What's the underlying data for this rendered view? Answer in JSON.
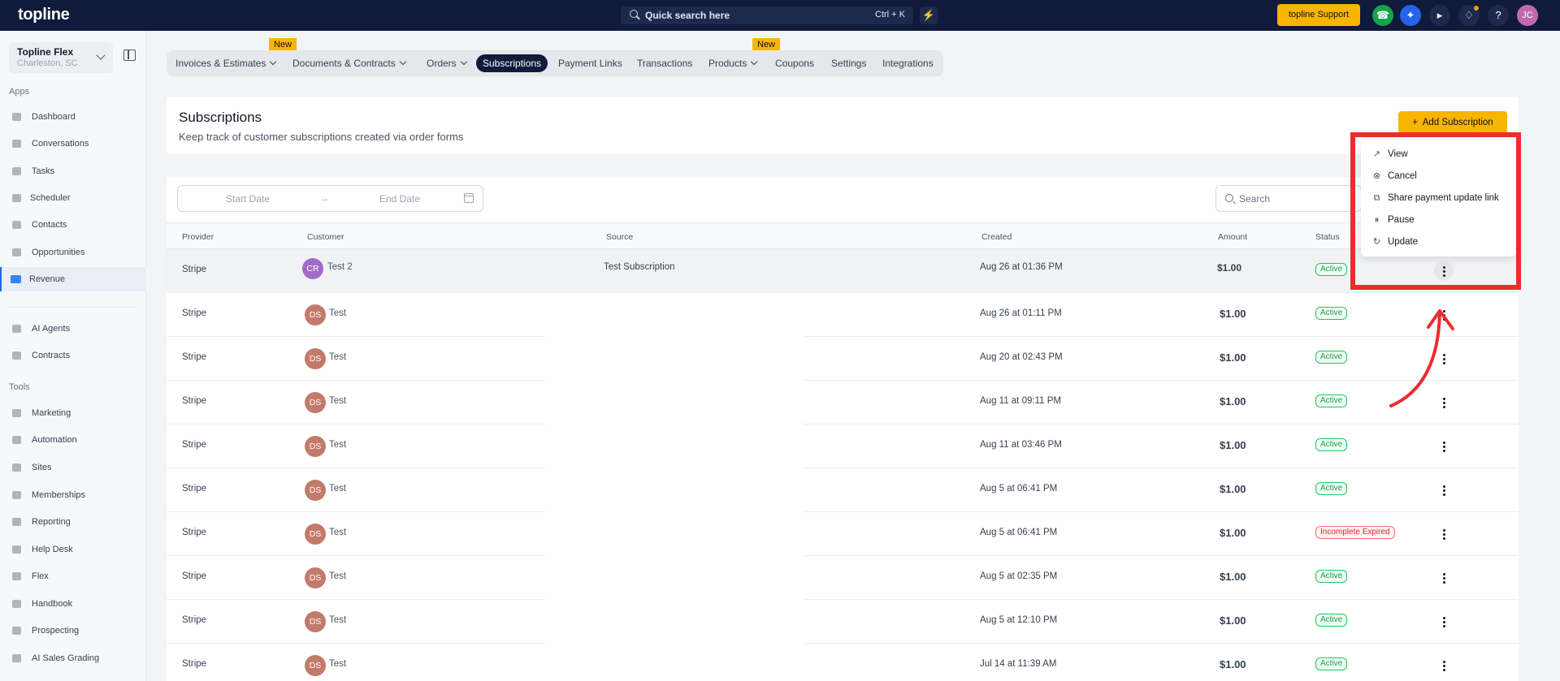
{
  "topbar": {
    "logo": "topline",
    "quick_search": "Quick search here",
    "shortcut": "Ctrl + K",
    "support_label": "topline Support",
    "user_initials": "JC"
  },
  "sidebar": {
    "location_name": "Topline Flex",
    "location_sub": "Charleston, SC",
    "apps_label": "Apps",
    "apps": [
      "Dashboard",
      "Conversations",
      "Tasks",
      "Scheduler",
      "Contacts",
      "Opportunities",
      "Revenue"
    ],
    "extra": [
      "AI Agents",
      "Contracts"
    ],
    "tools_label": "Tools",
    "tools": [
      "Marketing",
      "Automation",
      "Sites",
      "Memberships",
      "Reporting",
      "Help Desk",
      "Flex",
      "Handbook",
      "Prospecting",
      "AI Sales Grading"
    ]
  },
  "tabs": [
    "Invoices & Estimates",
    "Documents & Contracts",
    "Orders",
    "Subscriptions",
    "Payment Links",
    "Transactions",
    "Products",
    "Coupons",
    "Settings",
    "Integrations"
  ],
  "new_badge": "New",
  "header": {
    "title": "Subscriptions",
    "subtitle": "Keep track of customer subscriptions created via order forms",
    "add_button": "Add Subscription"
  },
  "filters": {
    "start_date": "Start Date",
    "end_date": "End Date",
    "search_placeholder": "Search"
  },
  "table": {
    "columns": [
      "Provider",
      "Customer",
      "Source",
      "Created",
      "Amount",
      "Status"
    ],
    "rows": [
      {
        "provider": "Stripe",
        "initials": "CR",
        "customer": "Test 2",
        "source": "Test Subscription",
        "created": "Aug 26 at 01:36 PM",
        "amount": "$1.00",
        "status": "Active"
      },
      {
        "provider": "Stripe",
        "initials": "DS",
        "customer": "Test",
        "source": "",
        "created": "Aug 26 at 01:11 PM",
        "amount": "$1.00",
        "status": "Active"
      },
      {
        "provider": "Stripe",
        "initials": "DS",
        "customer": "Test",
        "source": "",
        "created": "Aug 20 at 02:43 PM",
        "amount": "$1.00",
        "status": "Active"
      },
      {
        "provider": "Stripe",
        "initials": "DS",
        "customer": "Test",
        "source": "",
        "created": "Aug 11 at 09:11 PM",
        "amount": "$1.00",
        "status": "Active"
      },
      {
        "provider": "Stripe",
        "initials": "DS",
        "customer": "Test",
        "source": "",
        "created": "Aug 11 at 03:46 PM",
        "amount": "$1.00",
        "status": "Active"
      },
      {
        "provider": "Stripe",
        "initials": "DS",
        "customer": "Test",
        "source": "",
        "created": "Aug 5 at 06:41 PM",
        "amount": "$1.00",
        "status": "Active"
      },
      {
        "provider": "Stripe",
        "initials": "DS",
        "customer": "Test",
        "source": "",
        "created": "Aug 5 at 06:41 PM",
        "amount": "$1.00",
        "status": "Incomplete Expired"
      },
      {
        "provider": "Stripe",
        "initials": "DS",
        "customer": "Test",
        "source": "",
        "created": "Aug 5 at 02:35 PM",
        "amount": "$1.00",
        "status": "Active"
      },
      {
        "provider": "Stripe",
        "initials": "DS",
        "customer": "Test",
        "source": "",
        "created": "Aug 5 at 12:10 PM",
        "amount": "$1.00",
        "status": "Active"
      },
      {
        "provider": "Stripe",
        "initials": "DS",
        "customer": "Test",
        "source": "",
        "created": "Jul 14 at 11:39 AM",
        "amount": "$1.00",
        "status": "Active"
      }
    ]
  },
  "row_menu": [
    {
      "label": "View",
      "icon": "arrow-up-right-icon"
    },
    {
      "label": "Cancel",
      "icon": "cancel-circle-icon"
    },
    {
      "label": "Share payment update link",
      "icon": "external-link-icon"
    },
    {
      "label": "Pause",
      "icon": "pause-circle-icon"
    },
    {
      "label": "Update",
      "icon": "refresh-icon"
    }
  ],
  "colors": {
    "topbar": "#101a3a",
    "accent": "#f7b500",
    "annotation": "#ef2b2b",
    "active_status": "#16a34a",
    "expired_status": "#dc2626",
    "avatar_cr": "#a06cc8",
    "avatar_ds": "#c27a6a"
  }
}
